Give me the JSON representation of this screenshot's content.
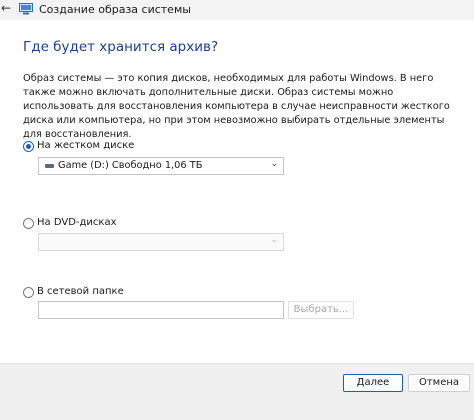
{
  "window": {
    "back_icon": "←",
    "title": "Создание образа системы"
  },
  "heading": "Где будет хранится архив?",
  "description": "Образ системы — это копия дисков, необходимых для работы Windows. В него также можно включать дополнительные диски. Образ системы можно использовать для восстановления компьютера в случае неисправности жесткого диска или компьютера, но при этом невозможно выбирать отдельные элементы для восстановления.",
  "options": {
    "hard_disk": {
      "label": "На жестком диске",
      "selected": true,
      "dropdown_value": "Game (D:)  Свободно 1,06 ТБ"
    },
    "dvd": {
      "label": "На DVD-дисках",
      "selected": false,
      "dropdown_value": ""
    },
    "network": {
      "label": "В сетевой папке",
      "selected": false,
      "path_value": "",
      "browse_label": "Выбрать..."
    }
  },
  "footer": {
    "next_label": "Далее",
    "cancel_label": "Отмена"
  },
  "colors": {
    "heading": "#1a3e9a",
    "accent": "#1a5fb4",
    "footer_bg": "#f0f0f0"
  },
  "icons": {
    "back": "arrow-left-icon",
    "app": "system-image-icon",
    "drive": "hard-drive-icon",
    "chevron": "chevron-down-icon"
  }
}
